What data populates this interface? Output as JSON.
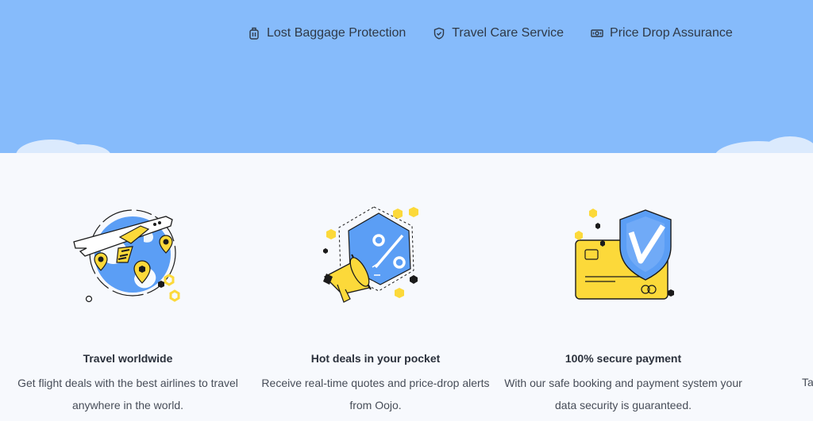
{
  "topnav": {
    "items": [
      {
        "label": "Lost Baggage Protection",
        "icon": "luggage-icon"
      },
      {
        "label": "Travel Care Service",
        "icon": "shield-icon"
      },
      {
        "label": "Price Drop Assurance",
        "icon": "money-icon"
      }
    ]
  },
  "features": [
    {
      "title": "Travel worldwide",
      "description": "Get flight deals with the best airlines to travel anywhere in the world.",
      "illustration": "plane-globe-illustration"
    },
    {
      "title": "Hot deals in your pocket",
      "description": "Receive real-time quotes and price-drop alerts from Oojo.",
      "illustration": "megaphone-discount-illustration"
    },
    {
      "title": "100% secure payment",
      "description": "With our safe booking and payment system your data security is guaranteed.",
      "illustration": "secure-card-illustration"
    }
  ],
  "partial_feature": {
    "text_fragment": "Ta"
  },
  "colors": {
    "sky": "#86bbfb",
    "accent_yellow": "#fcd93a",
    "accent_blue": "#5b9ef5",
    "background": "#f7f9fd"
  }
}
